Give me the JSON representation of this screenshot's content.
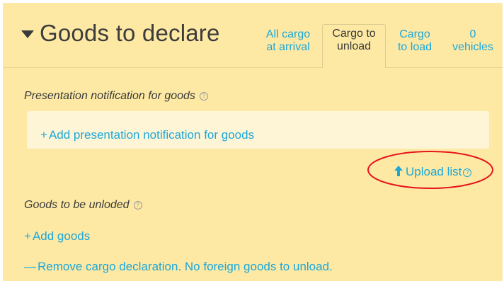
{
  "header": {
    "title": "Goods to declare",
    "tabs": [
      {
        "line1": "All cargo",
        "line2": "at arrival",
        "active": false
      },
      {
        "line1": "Cargo to",
        "line2": "unload",
        "active": true
      },
      {
        "line1": "Cargo",
        "line2": "to load",
        "active": false
      },
      {
        "line1": "0",
        "line2": "vehicles",
        "active": false
      }
    ]
  },
  "presentation": {
    "label": "Presentation notification for goods",
    "add_label": "Add presentation notification for goods",
    "upload_label": "Upload list"
  },
  "goods": {
    "label": "Goods to be unloded",
    "add_label": "Add goods",
    "remove_label": "Remove cargo declaration. No foreign goods to unload."
  },
  "icons": {
    "section_toggle": "triangle-down-icon",
    "help": "question-circle-icon",
    "add": "plus-icon",
    "remove": "minus-icon",
    "upload": "arrow-up-icon"
  },
  "colors": {
    "panel_background": "#fde9a4",
    "box_background": "#fef5d6",
    "link": "#1ca7da",
    "text": "#3a3a3a",
    "annotation": "#e8141c"
  }
}
